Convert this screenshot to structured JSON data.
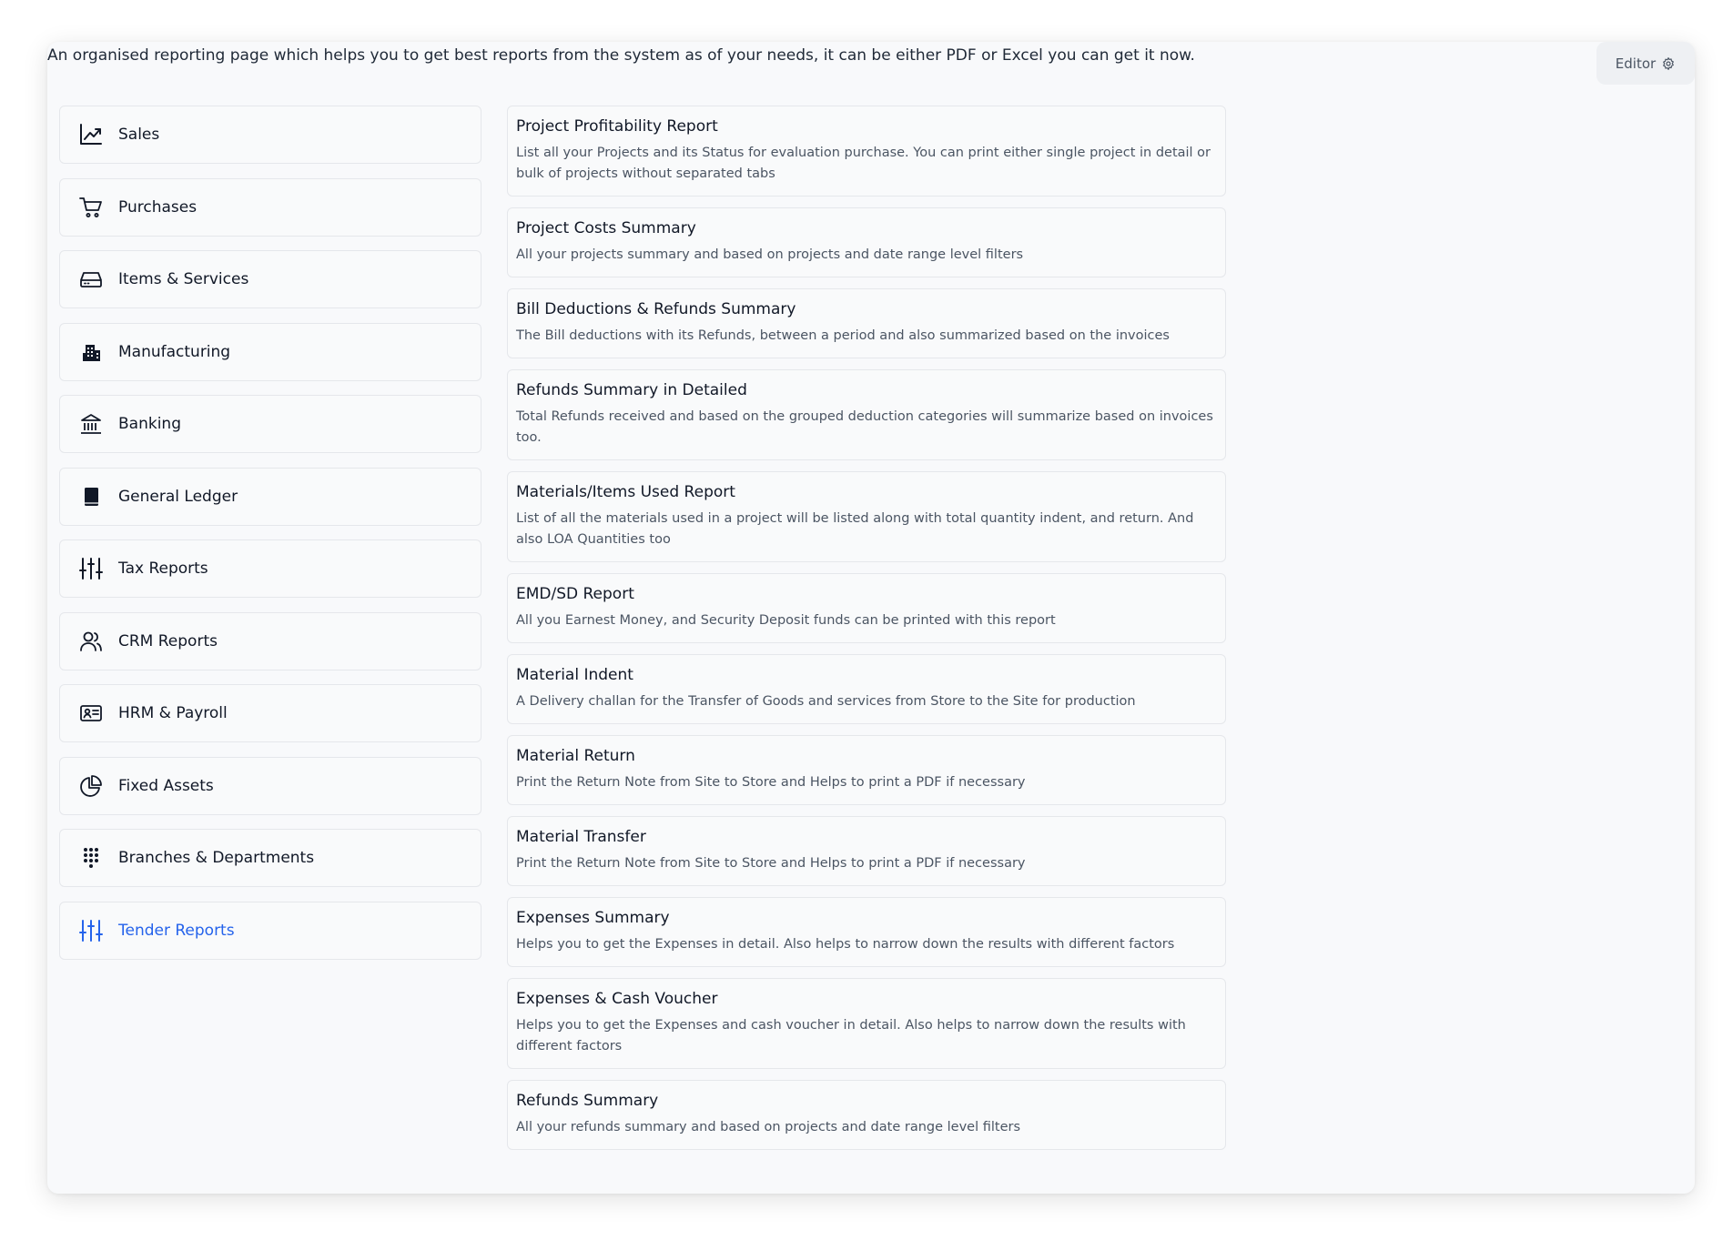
{
  "header": {
    "intro": "An organised reporting page which helps you to get best reports from the system as of your needs, it can be either PDF or Excel you can get it now.",
    "editor_label": "Editor"
  },
  "sidebar": {
    "items": [
      {
        "label": "Sales",
        "icon": "trending-up-icon"
      },
      {
        "label": "Purchases",
        "icon": "shopping-cart-icon"
      },
      {
        "label": "Items & Services",
        "icon": "drive-icon"
      },
      {
        "label": "Manufacturing",
        "icon": "building-icon"
      },
      {
        "label": "Banking",
        "icon": "bank-icon"
      },
      {
        "label": "General Ledger",
        "icon": "book-icon"
      },
      {
        "label": "Tax Reports",
        "icon": "sliders-icon"
      },
      {
        "label": "CRM Reports",
        "icon": "users-icon"
      },
      {
        "label": "HRM & Payroll",
        "icon": "id-card-icon"
      },
      {
        "label": "Fixed Assets",
        "icon": "pie-chart-icon"
      },
      {
        "label": "Branches & Departments",
        "icon": "dots-grid-icon"
      },
      {
        "label": "Tender Reports",
        "icon": "sliders-icon",
        "active": true
      }
    ],
    "active_color": "#2563eb"
  },
  "reports": [
    {
      "title": "Project Profitability Report",
      "desc": "List all your Projects and its Status for evaluation purchase. You can print either single project in detail or bulk of projects without separated tabs"
    },
    {
      "title": "Project Costs Summary",
      "desc": "All your projects summary and based on projects and date range level filters"
    },
    {
      "title": "Bill Deductions & Refunds Summary",
      "desc": "The Bill deductions with its Refunds, between a period and also summarized based on the invoices"
    },
    {
      "title": "Refunds Summary in Detailed",
      "desc": "Total Refunds received and based on the grouped deduction categories will summarize based on invoices too."
    },
    {
      "title": "Materials/Items Used Report",
      "desc": "List of all the materials used in a project will be listed along with total quantity indent, and return. And also LOA Quantities too"
    },
    {
      "title": "EMD/SD Report",
      "desc": "All you Earnest Money, and Security Deposit funds can be printed with this report"
    },
    {
      "title": "Material Indent",
      "desc": "A Delivery challan for the Transfer of Goods and services from Store to the Site for production"
    },
    {
      "title": "Material Return",
      "desc": "Print the Return Note from Site to Store and Helps to print a PDF if necessary"
    },
    {
      "title": "Material Transfer",
      "desc": "Print the Return Note from Site to Store and Helps to print a PDF if necessary"
    },
    {
      "title": "Expenses Summary",
      "desc": "Helps you to get the Expenses in detail. Also helps to narrow down the results with different factors"
    },
    {
      "title": "Expenses & Cash Voucher",
      "desc": "Helps you to get the Expenses and cash voucher in detail. Also helps to narrow down the results with different factors"
    },
    {
      "title": "Refunds Summary",
      "desc": "All your refunds summary and based on projects and date range level filters"
    }
  ]
}
